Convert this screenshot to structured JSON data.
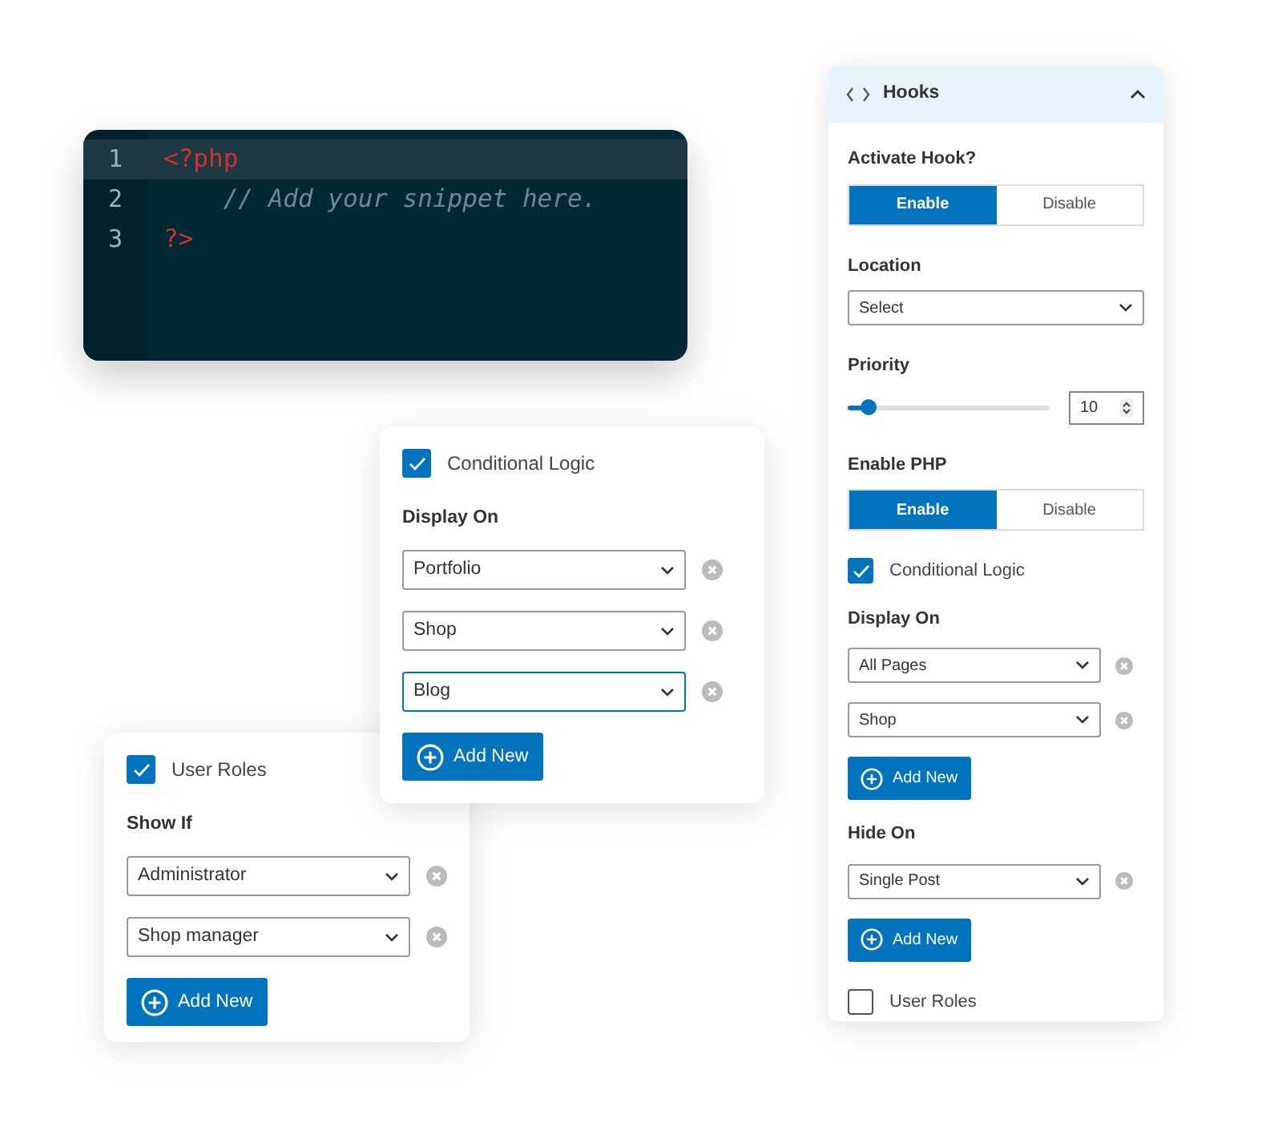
{
  "code_editor": {
    "lines": [
      {
        "number": "1",
        "current": true,
        "tokens": [
          {
            "text": "<?php",
            "kind": "tag"
          }
        ]
      },
      {
        "number": "2",
        "current": false,
        "tokens": [
          {
            "text": "    // Add your snippet here.",
            "kind": "comment"
          }
        ]
      },
      {
        "number": "3",
        "current": false,
        "tokens": [
          {
            "text": "?>",
            "kind": "tag"
          }
        ]
      }
    ]
  },
  "hooks_panel": {
    "title": "Hooks",
    "expanded": true,
    "items": [
      {
        "kind": "toggle",
        "label": "Activate Hook?",
        "options": [
          {
            "label": "Enable",
            "selected": true
          },
          {
            "label": "Disable",
            "selected": false
          }
        ]
      },
      {
        "kind": "select",
        "label": "Location",
        "value": "Select"
      },
      {
        "kind": "slider",
        "label": "Priority",
        "level": 0.1,
        "value": "10"
      },
      {
        "kind": "toggle",
        "label": "Enable PHP",
        "options": [
          {
            "label": "Enable",
            "selected": true
          },
          {
            "label": "Disable",
            "selected": false
          }
        ]
      },
      {
        "kind": "checkbox",
        "label": "Conditional Logic",
        "checked": true
      },
      {
        "kind": "rules",
        "label": "Display On",
        "rows": [
          {
            "value": "All Pages",
            "focused": false
          },
          {
            "value": "Shop",
            "focused": false
          }
        ],
        "button": "Add New"
      },
      {
        "kind": "rules",
        "label": "Hide On",
        "rows": [
          {
            "value": "Single Post",
            "focused": false
          }
        ],
        "button": "Add New"
      },
      {
        "kind": "checkbox",
        "label": "User Roles",
        "checked": false
      }
    ]
  },
  "conditional_logic_card": {
    "checkbox": {
      "label": "Conditional Logic",
      "checked": true
    },
    "label": "Display On",
    "rows": [
      {
        "value": "Portfolio",
        "focused": false
      },
      {
        "value": "Shop",
        "focused": false
      },
      {
        "value": "Blog",
        "focused": true
      }
    ],
    "button": "Add New"
  },
  "user_roles_card": {
    "checkbox": {
      "label": "User Roles",
      "checked": true
    },
    "label": "Show If",
    "rows": [
      {
        "value": "Administrator",
        "focused": false
      },
      {
        "value": "Shop manager",
        "focused": false
      }
    ],
    "button": "Add New"
  }
}
